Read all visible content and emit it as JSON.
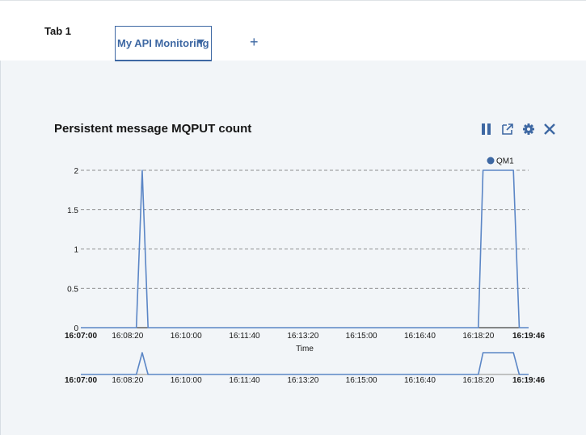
{
  "tabs": [
    {
      "label": "Tab 1"
    },
    {
      "label": "My API Monitoring"
    }
  ],
  "add_tab_label": "+",
  "widget": {
    "title": "Persistent message MQPUT count",
    "controls": [
      "pause-icon",
      "launch-icon",
      "settings-icon",
      "close-icon"
    ]
  },
  "colors": {
    "accent": "#3e68a3",
    "series": "#5b86c6",
    "background": "#f2f5f8"
  },
  "chart_data": {
    "type": "line",
    "title": "Persistent message MQPUT count",
    "xlabel": "Time",
    "ylabel": "",
    "x_tick_labels": [
      "16:07:00",
      "16:08:20",
      "16:10:00",
      "16:11:40",
      "16:13:20",
      "16:15:00",
      "16:16:40",
      "16:18:20",
      "16:19:46"
    ],
    "x_bold_ticks": [
      "16:07:00",
      "16:19:46"
    ],
    "y_tick_labels": [
      "0",
      "0.5",
      "1",
      "1.5",
      "2"
    ],
    "ylim": [
      0,
      2
    ],
    "grid": "horizontal dashed",
    "legend_position": "top-right",
    "series": [
      {
        "name": "QM1",
        "points": [
          [
            "16:07:00",
            0
          ],
          [
            "16:08:35",
            0
          ],
          [
            "16:08:45",
            2
          ],
          [
            "16:08:55",
            0
          ],
          [
            "16:18:20",
            0
          ],
          [
            "16:18:28",
            2
          ],
          [
            "16:19:20",
            2
          ],
          [
            "16:19:30",
            0
          ],
          [
            "16:19:46",
            0
          ]
        ]
      }
    ]
  }
}
